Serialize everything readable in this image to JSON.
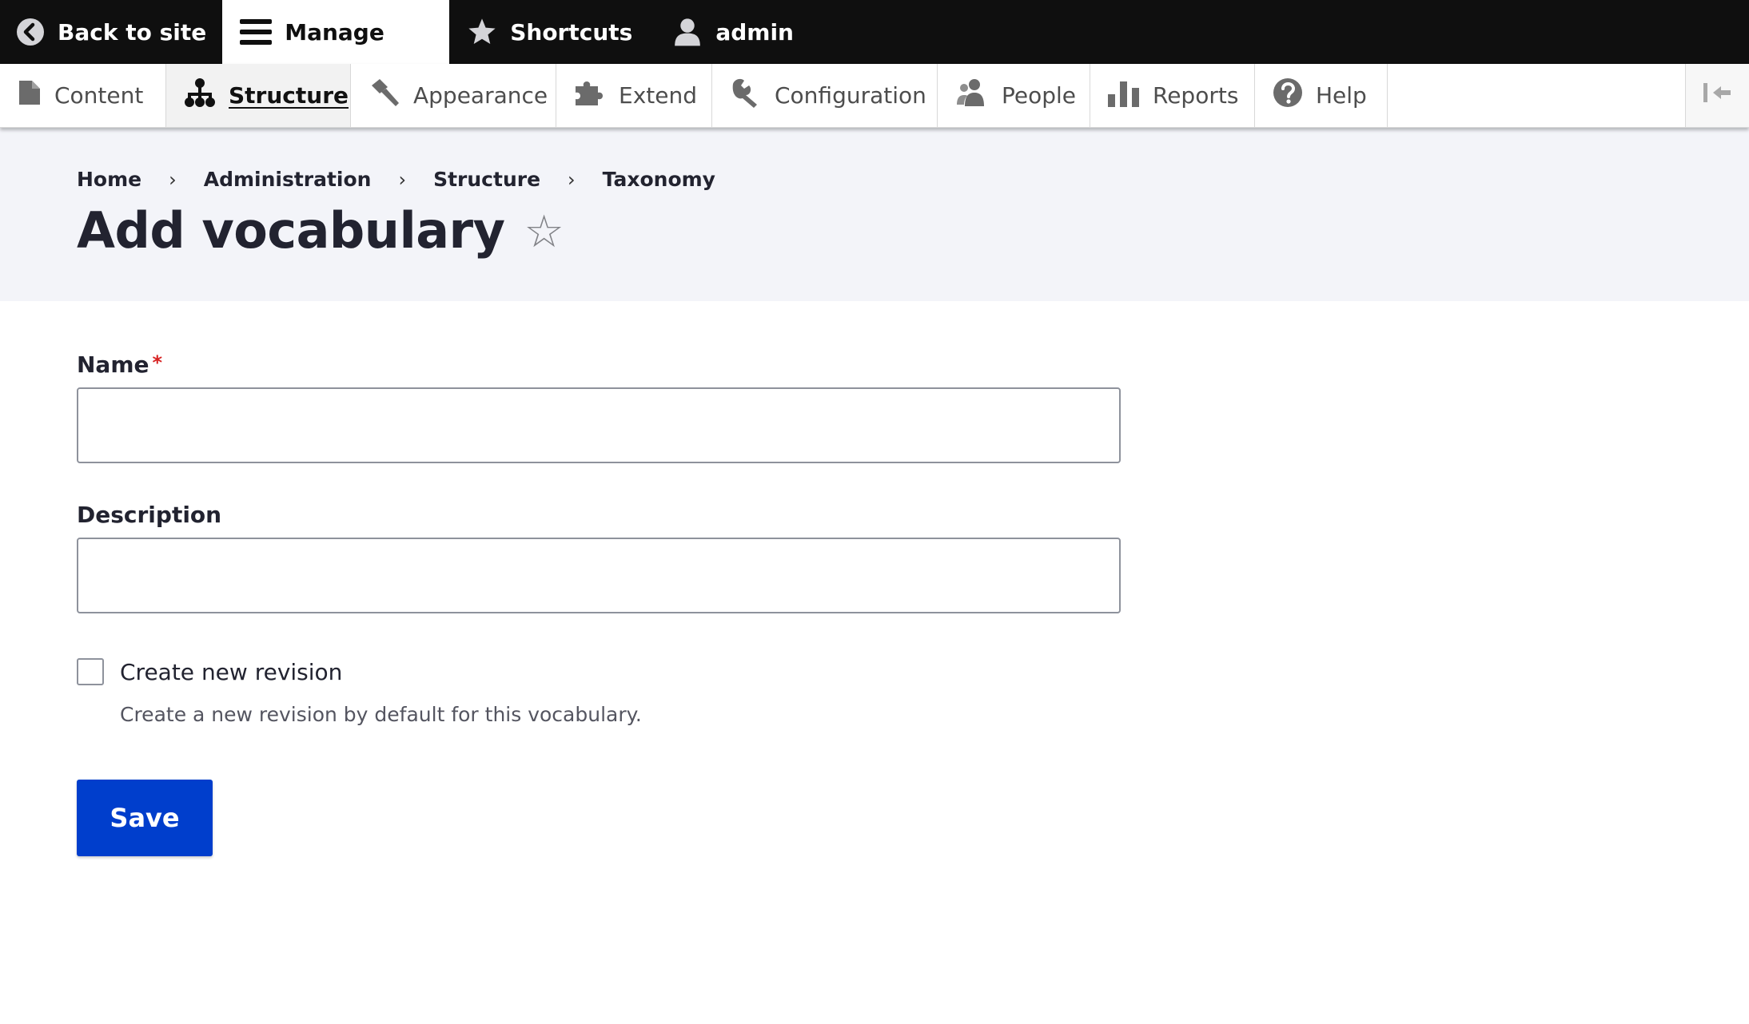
{
  "toolbar": {
    "back_label": "Back to site",
    "manage_label": "Manage",
    "shortcuts_label": "Shortcuts",
    "user_label": "admin"
  },
  "tray": {
    "items": [
      {
        "label": "Content",
        "icon": "document-icon"
      },
      {
        "label": "Structure",
        "icon": "sitemap-icon",
        "active": true
      },
      {
        "label": "Appearance",
        "icon": "paintbrush-icon"
      },
      {
        "label": "Extend",
        "icon": "puzzle-icon"
      },
      {
        "label": "Configuration",
        "icon": "wrench-icon"
      },
      {
        "label": "People",
        "icon": "people-icon"
      },
      {
        "label": "Reports",
        "icon": "bar-chart-icon"
      },
      {
        "label": "Help",
        "icon": "help-icon"
      }
    ]
  },
  "breadcrumb": [
    "Home",
    "Administration",
    "Structure",
    "Taxonomy"
  ],
  "breadcrumb_separator": "›",
  "page": {
    "title": "Add vocabulary",
    "shortcut_star": "☆"
  },
  "form": {
    "name_label": "Name",
    "required_mark": "*",
    "name_value": "",
    "description_label": "Description",
    "description_value": "",
    "revision_label": "Create new revision",
    "revision_checked": false,
    "revision_description": "Create a new revision by default for this vocabulary.",
    "save_label": "Save"
  },
  "colors": {
    "toolbar_bg": "#0f0f0f",
    "header_bg": "#f3f4f9",
    "primary_button": "#003ecc",
    "required": "#d72222"
  }
}
